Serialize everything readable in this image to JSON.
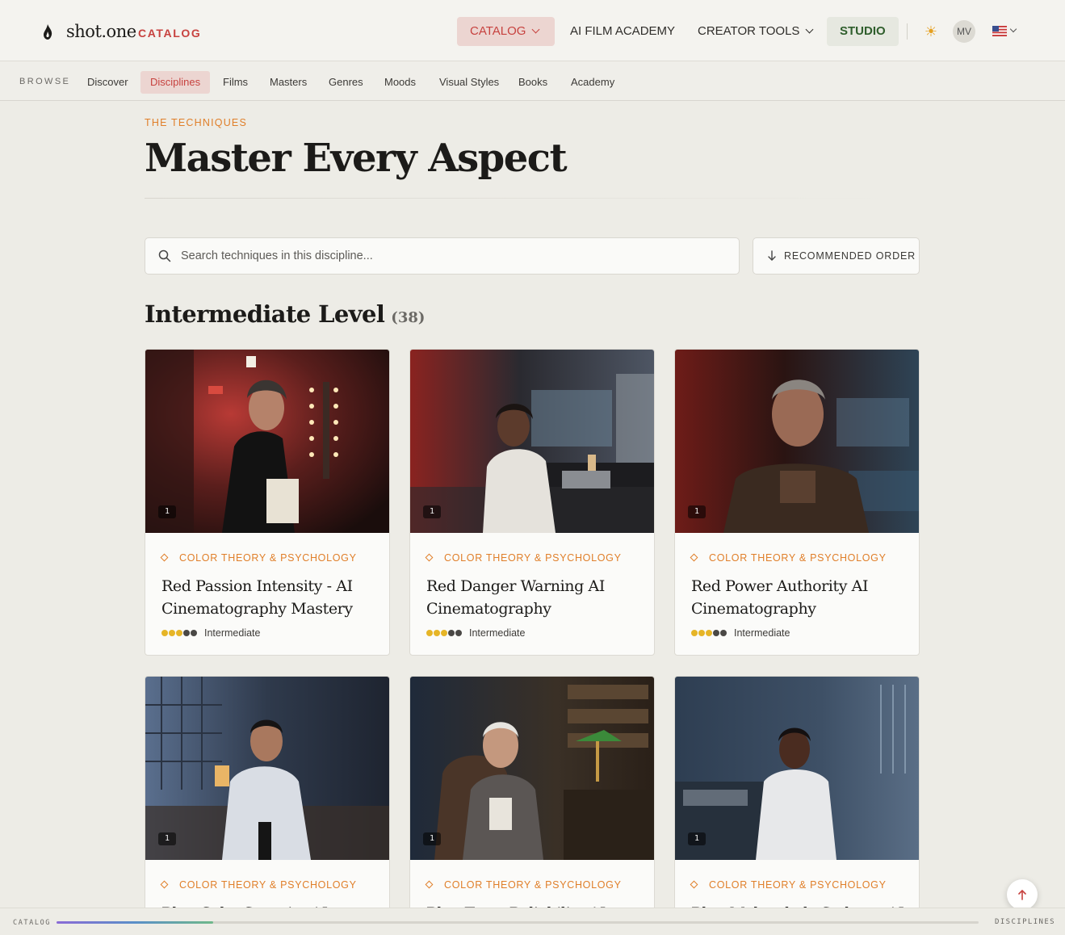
{
  "header": {
    "logo_text": "shot.one",
    "logo_sub": "CATALOG",
    "nav": {
      "catalog": "CATALOG",
      "academy": "AI FILM ACADEMY",
      "tools": "CREATOR TOOLS",
      "studio": "STUDIO"
    },
    "avatar_initials": "MV",
    "language_flag": "us-flag-icon"
  },
  "subnav": {
    "label": "BROWSE",
    "items": [
      "Discover",
      "Disciplines",
      "Films",
      "Masters",
      "Genres",
      "Moods",
      "Visual Styles",
      "Books",
      "Academy"
    ],
    "active": "Disciplines"
  },
  "hero": {
    "eyebrow": "THE TECHNIQUES",
    "title": "Master Every Aspect"
  },
  "search": {
    "placeholder": "Search techniques in this discipline..."
  },
  "order_button": "RECOMMENDED ORDER",
  "section": {
    "title": "Intermediate Level",
    "count": "(38)"
  },
  "cards": [
    {
      "badge": "1",
      "category": "COLOR THEORY & PSYCHOLOGY",
      "title": "Red Passion Intensity - AI Cinematography Mastery",
      "level": "Intermediate",
      "level_dots": 3
    },
    {
      "badge": "1",
      "category": "COLOR THEORY & PSYCHOLOGY",
      "title": "Red Danger Warning AI Cinematography",
      "level": "Intermediate",
      "level_dots": 3
    },
    {
      "badge": "1",
      "category": "COLOR THEORY & PSYCHOLOGY",
      "title": "Red Power Authority AI Cinematography",
      "level": "Intermediate",
      "level_dots": 3
    },
    {
      "badge": "1",
      "category": "COLOR THEORY & PSYCHOLOGY",
      "title": "Blue Calm Serenity AI",
      "level": "",
      "level_dots": 0
    },
    {
      "badge": "1",
      "category": "COLOR THEORY & PSYCHOLOGY",
      "title": "Blue Trust Reliability AI",
      "level": "",
      "level_dots": 0
    },
    {
      "badge": "1",
      "category": "COLOR THEORY & PSYCHOLOGY",
      "title": "Blue Melancholy Sadness AI",
      "level": "",
      "level_dots": 0
    }
  ],
  "footer": {
    "left": "CATALOG",
    "right": "DISCIPLINES",
    "progress": 0.17
  },
  "colors": {
    "accent_red": "#c7423f",
    "accent_orange": "#e07f2a",
    "studio_green": "#2f5e2c",
    "level_dot": "#e6b527",
    "background": "#edece6"
  }
}
